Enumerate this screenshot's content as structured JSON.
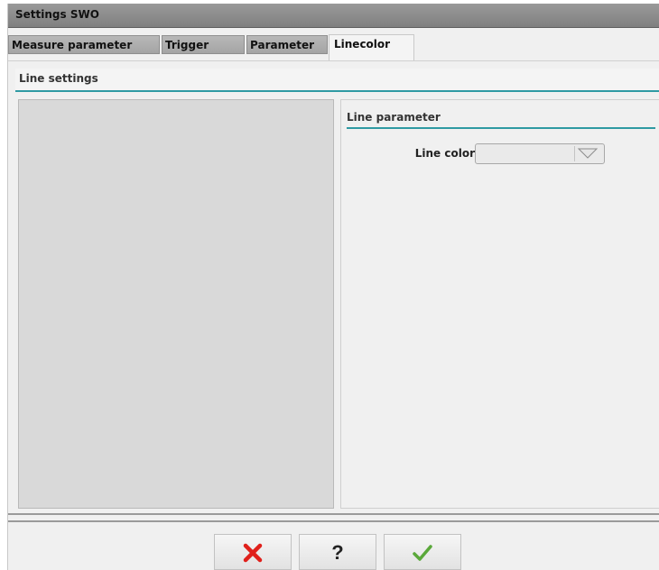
{
  "window": {
    "title": "Settings SWO"
  },
  "tabs": [
    {
      "label": "Measure parameter",
      "active": false
    },
    {
      "label": "Trigger",
      "active": false
    },
    {
      "label": "Parameter",
      "active": false
    },
    {
      "label": "Linecolor",
      "active": true
    }
  ],
  "section": {
    "title": "Line settings"
  },
  "line_parameter": {
    "title": "Line parameter",
    "line_color_label": "Line color",
    "line_color_value": ""
  },
  "buttons": {
    "cancel_icon": "cancel-x-icon",
    "help_label": "?",
    "confirm_icon": "checkmark-icon"
  },
  "colors": {
    "accent": "#2f9aa3",
    "cancel": "#e0201b",
    "confirm": "#5aa83a"
  }
}
